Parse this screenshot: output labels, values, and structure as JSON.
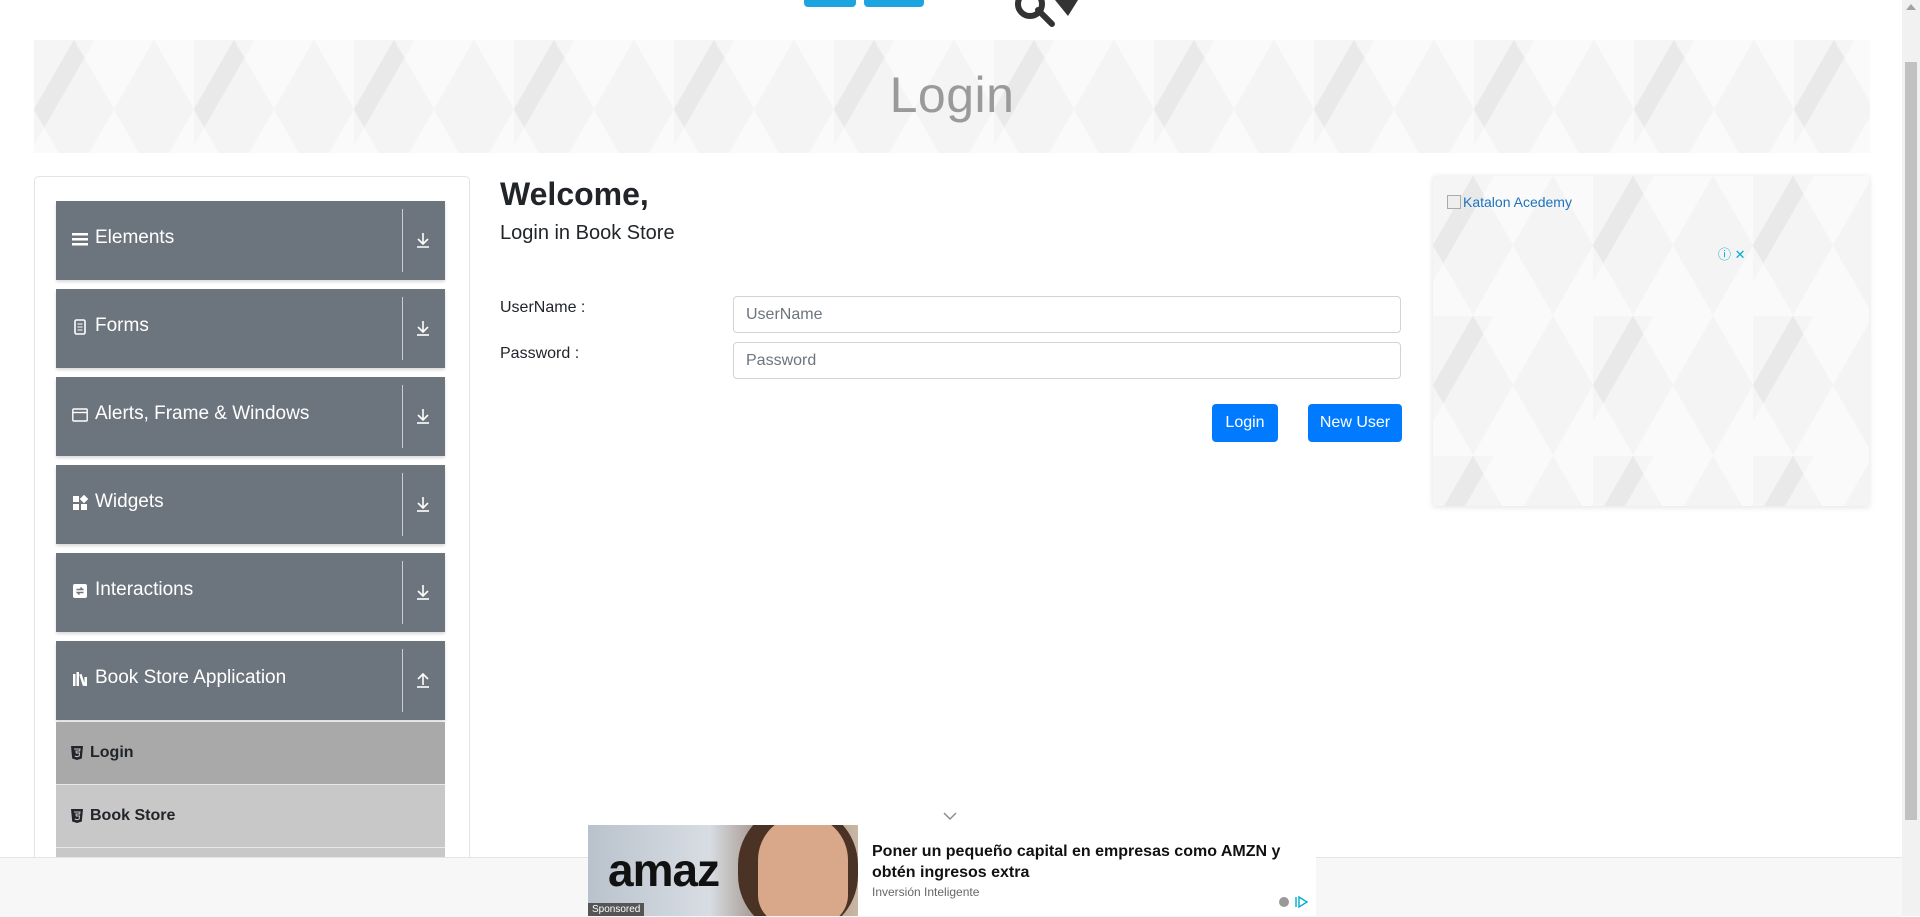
{
  "banner": {
    "title": "Login"
  },
  "sidebar": {
    "groups": [
      {
        "label": "Elements",
        "icon": "list-icon",
        "state": "collapsed"
      },
      {
        "label": "Forms",
        "icon": "document-icon",
        "state": "collapsed"
      },
      {
        "label": "Alerts, Frame & Windows",
        "icon": "window-icon",
        "state": "collapsed"
      },
      {
        "label": "Widgets",
        "icon": "widgets-icon",
        "state": "collapsed"
      },
      {
        "label": "Interactions",
        "icon": "interactions-icon",
        "state": "collapsed"
      },
      {
        "label": "Book Store Application",
        "icon": "books-icon",
        "state": "expanded"
      }
    ],
    "bookstore_items": [
      {
        "label": "Login",
        "active": true
      },
      {
        "label": "Book Store",
        "active": false
      }
    ]
  },
  "main": {
    "heading": "Welcome,",
    "subheading": "Login in Book Store",
    "username_label": "UserName :",
    "username_placeholder": "UserName",
    "username_value": "",
    "password_label": "Password :",
    "password_placeholder": "Password",
    "password_value": "",
    "login_button": "Login",
    "new_user_button": "New User"
  },
  "ad_right": {
    "image_alt": "Katalon Acedemy",
    "close_label": "ⓘ ✕"
  },
  "ad_bottom": {
    "brand_text": "amaz",
    "headline": "Poner un pequeño capital en empresas como AMZN y obtén ingresos extra",
    "source": "Inversión Inteligente",
    "sponsored": "Sponsored"
  },
  "colors": {
    "accent": "#007bff",
    "sidebar_group": "#6c757d",
    "active_item": "#a9a9a9",
    "logo_blue": "#1ba4e0"
  }
}
